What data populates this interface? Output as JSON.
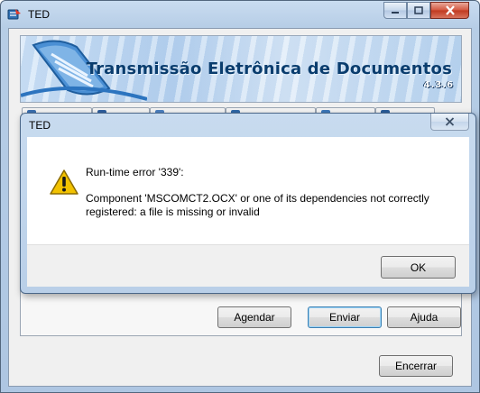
{
  "main_window": {
    "title": "TED",
    "icon": "ted-app-icon",
    "controls": [
      "minimize",
      "maximize",
      "close"
    ]
  },
  "banner": {
    "title": "Transmissão Eletrônica de Documentos",
    "version": "4.3.6"
  },
  "buttons": {
    "agendar": "Agendar",
    "enviar": "Enviar",
    "ajuda": "Ajuda",
    "encerrar": "Encerrar"
  },
  "error_dialog": {
    "title": "TED",
    "icon": "warning-icon",
    "heading": "Run-time error '339':",
    "message": "Component 'MSCOMCT2.OCX' or one of its dependencies not correctly registered: a file is missing or invalid",
    "ok_label": "OK"
  },
  "colors": {
    "banner_title": "#0a3d6e",
    "dialog_frame": "#b9cfe8",
    "warning": "#f2c200"
  }
}
